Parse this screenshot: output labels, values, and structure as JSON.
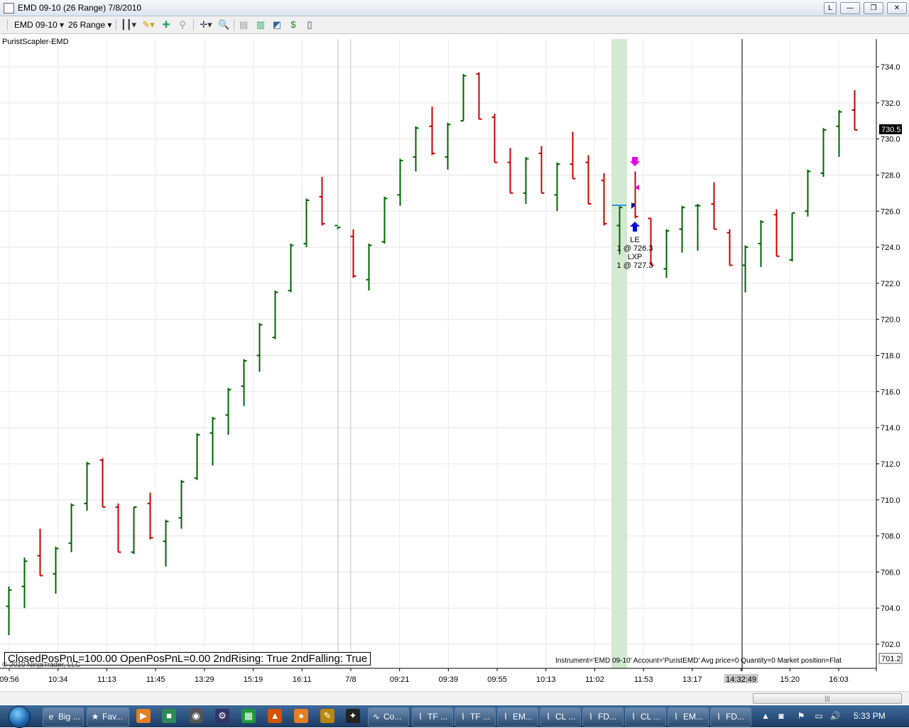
{
  "window": {
    "title": "EMD 09-10 (26 Range)  7/8/2010",
    "buttons": [
      "L",
      "—",
      "❐",
      "✕"
    ]
  },
  "toolbar": {
    "instrument": "EMD 09-10 ▾",
    "period": "26 Range ▾"
  },
  "indicator_label": "PuristScapler-EMD",
  "pnl_text": "ClosedPosPnL=100.00 OpenPosPnL=0.00 2ndRising: True 2ndFalling: True",
  "copyright": "© 2010 NinjaTrader, LLC",
  "status_line": "Instrument='EMD 09-10' Account='PuristEMD' Avg price=0 Quantity=0 Market position=Flat",
  "colors": {
    "up": "#006400",
    "down": "#cc0000",
    "highlight": "#d3e9d1",
    "axis": "#000000"
  },
  "chart_data": {
    "type": "ohlc",
    "yticks": [
      702,
      704,
      706,
      708,
      710,
      712,
      714,
      716,
      718,
      720,
      722,
      724,
      726,
      728,
      730,
      732,
      734
    ],
    "ylim": [
      700.5,
      735.5
    ],
    "current_price_label": "730.5",
    "bottom_price_label": "701.2",
    "xlabels": [
      "09:56",
      "10:34",
      "11:13",
      "11:45",
      "13:29",
      "15:19",
      "16:11",
      "7/8",
      "09:21",
      "09:39",
      "09:55",
      "10:13",
      "11:02",
      "11:53",
      "13:17",
      "14:32:49",
      "15:20",
      "16:03"
    ],
    "bars": [
      {
        "t": "09:56",
        "open": 704.1,
        "high": 705.2,
        "low": 702.5,
        "close": 705.0,
        "dir": "up"
      },
      {
        "open": 705.2,
        "high": 706.8,
        "low": 704.0,
        "close": 706.6,
        "dir": "up"
      },
      {
        "open": 706.9,
        "high": 708.4,
        "low": 705.8,
        "close": 705.8,
        "dir": "down"
      },
      {
        "open": 705.9,
        "high": 707.4,
        "low": 704.8,
        "close": 707.3,
        "dir": "up"
      },
      {
        "open": 707.6,
        "high": 709.8,
        "low": 707.1,
        "close": 709.7,
        "dir": "up"
      },
      {
        "open": 709.8,
        "high": 712.1,
        "low": 709.4,
        "close": 712.0,
        "dir": "up"
      },
      {
        "open": 712.2,
        "high": 712.3,
        "low": 709.6,
        "close": 709.6,
        "dir": "down"
      },
      {
        "open": 709.6,
        "high": 709.8,
        "low": 707.1,
        "close": 707.1,
        "dir": "down"
      },
      {
        "open": 707.1,
        "high": 709.6,
        "low": 707.0,
        "close": 709.6,
        "dir": "up"
      },
      {
        "open": 709.8,
        "high": 710.4,
        "low": 707.8,
        "close": 707.9,
        "dir": "down"
      },
      {
        "open": 707.7,
        "high": 708.9,
        "low": 706.3,
        "close": 708.8,
        "dir": "up"
      },
      {
        "open": 709.0,
        "high": 711.1,
        "low": 708.4,
        "close": 711.0,
        "dir": "up"
      },
      {
        "open": 711.2,
        "high": 713.7,
        "low": 711.1,
        "close": 713.6,
        "dir": "up"
      },
      {
        "open": 713.7,
        "high": 714.6,
        "low": 711.9,
        "close": 714.5,
        "dir": "up"
      },
      {
        "open": 714.7,
        "high": 716.2,
        "low": 713.6,
        "close": 716.1,
        "dir": "up"
      },
      {
        "open": 716.3,
        "high": 717.8,
        "low": 715.2,
        "close": 717.7,
        "dir": "up"
      },
      {
        "open": 718.0,
        "high": 719.8,
        "low": 717.1,
        "close": 719.7,
        "dir": "up"
      },
      {
        "open": 719.0,
        "high": 721.6,
        "low": 718.9,
        "close": 721.5,
        "dir": "up"
      },
      {
        "open": 721.6,
        "high": 724.2,
        "low": 721.5,
        "close": 724.1,
        "dir": "up"
      },
      {
        "open": 724.2,
        "high": 726.7,
        "low": 724.0,
        "close": 726.6,
        "dir": "up"
      },
      {
        "open": 726.8,
        "high": 727.9,
        "low": 725.2,
        "close": 725.3,
        "dir": "down"
      },
      {
        "open": 725.2,
        "high": 725.1,
        "low": 725.0,
        "close": 725.1,
        "dir": "up"
      },
      {
        "open": 724.6,
        "high": 725.0,
        "low": 722.3,
        "close": 722.4,
        "dir": "down"
      },
      {
        "open": 722.2,
        "high": 724.2,
        "low": 721.6,
        "close": 724.1,
        "dir": "up"
      },
      {
        "open": 724.3,
        "high": 726.8,
        "low": 724.2,
        "close": 726.7,
        "dir": "up"
      },
      {
        "open": 726.9,
        "high": 728.9,
        "low": 726.3,
        "close": 728.8,
        "dir": "up"
      },
      {
        "open": 729.0,
        "high": 730.7,
        "low": 728.2,
        "close": 730.6,
        "dir": "up"
      },
      {
        "open": 730.7,
        "high": 731.8,
        "low": 729.1,
        "close": 729.2,
        "dir": "down"
      },
      {
        "open": 729.0,
        "high": 730.9,
        "low": 728.3,
        "close": 730.8,
        "dir": "up"
      },
      {
        "open": 731.0,
        "high": 733.6,
        "low": 731.0,
        "close": 733.5,
        "dir": "up"
      },
      {
        "open": 733.6,
        "high": 733.7,
        "low": 731.1,
        "close": 731.1,
        "dir": "down"
      },
      {
        "open": 731.2,
        "high": 731.4,
        "low": 728.7,
        "close": 728.7,
        "dir": "down"
      },
      {
        "open": 728.7,
        "high": 729.5,
        "low": 727.0,
        "close": 727.0,
        "dir": "down"
      },
      {
        "open": 727.0,
        "high": 729.0,
        "low": 726.4,
        "close": 728.9,
        "dir": "up"
      },
      {
        "open": 729.2,
        "high": 729.6,
        "low": 727.0,
        "close": 727.0,
        "dir": "down"
      },
      {
        "open": 726.9,
        "high": 728.7,
        "low": 726.0,
        "close": 728.6,
        "dir": "up"
      },
      {
        "open": 728.6,
        "high": 730.4,
        "low": 727.8,
        "close": 727.8,
        "dir": "down"
      },
      {
        "open": 728.7,
        "high": 729.1,
        "low": 726.4,
        "close": 726.4,
        "dir": "down"
      },
      {
        "open": 727.7,
        "high": 728.1,
        "low": 725.2,
        "close": 725.3,
        "dir": "down"
      },
      {
        "open": 725.2,
        "high": 726.3,
        "low": 723.6,
        "close": 726.2,
        "dir": "up"
      },
      {
        "open": 726.4,
        "high": 728.2,
        "low": 725.6,
        "close": 725.7,
        "dir": "down"
      },
      {
        "open": 725.6,
        "high": 725.6,
        "low": 723.0,
        "close": 723.0,
        "dir": "down"
      },
      {
        "open": 722.8,
        "high": 725.0,
        "low": 722.3,
        "close": 724.9,
        "dir": "up"
      },
      {
        "open": 725.0,
        "high": 726.3,
        "low": 723.7,
        "close": 726.2,
        "dir": "up"
      },
      {
        "open": 726.3,
        "high": 726.4,
        "low": 723.8,
        "close": 726.3,
        "dir": "up"
      },
      {
        "open": 726.4,
        "high": 727.6,
        "low": 725.0,
        "close": 725.0,
        "dir": "down"
      },
      {
        "open": 724.8,
        "high": 725.0,
        "low": 723.0,
        "close": 723.0,
        "dir": "down"
      },
      {
        "open": 723.0,
        "high": 724.1,
        "low": 721.5,
        "close": 724.0,
        "dir": "up"
      },
      {
        "open": 724.2,
        "high": 725.5,
        "low": 722.9,
        "close": 725.4,
        "dir": "up"
      },
      {
        "open": 725.8,
        "high": 726.1,
        "low": 723.5,
        "close": 723.5,
        "dir": "down"
      },
      {
        "open": 723.3,
        "high": 725.9,
        "low": 723.2,
        "close": 725.9,
        "dir": "up"
      },
      {
        "open": 726.0,
        "high": 728.3,
        "low": 725.7,
        "close": 728.2,
        "dir": "up"
      },
      {
        "open": 728.1,
        "high": 730.6,
        "low": 727.9,
        "close": 730.5,
        "dir": "up"
      },
      {
        "open": 730.7,
        "high": 731.6,
        "low": 729.0,
        "close": 731.5,
        "dir": "up"
      },
      {
        "open": 731.6,
        "high": 732.7,
        "low": 730.5,
        "close": 730.5,
        "dir": "down"
      }
    ],
    "annotations": {
      "entry_label": "LE",
      "entry_detail": "1 @ 726.3",
      "exit_label": "LXP",
      "exit_detail": "1 @ 727.3"
    }
  },
  "taskbar": {
    "buttons": [
      {
        "label": "Big ...",
        "icon": "ie-icon"
      },
      {
        "label": "Fav...",
        "icon": "star-icon"
      },
      {
        "label": "Co...",
        "icon": "ninja-icon"
      },
      {
        "label": "TF ...",
        "icon": "chart-icon"
      },
      {
        "label": "TF ...",
        "icon": "chart-icon"
      },
      {
        "label": "EM...",
        "icon": "chart-icon"
      },
      {
        "label": "CL ...",
        "icon": "chart-icon"
      },
      {
        "label": "FD...",
        "icon": "chart-icon"
      },
      {
        "label": "CL ...",
        "icon": "chart-icon"
      },
      {
        "label": "EM...",
        "icon": "chart-icon"
      },
      {
        "label": "FD...",
        "icon": "chart-icon"
      }
    ],
    "clock": "5:33 PM"
  }
}
